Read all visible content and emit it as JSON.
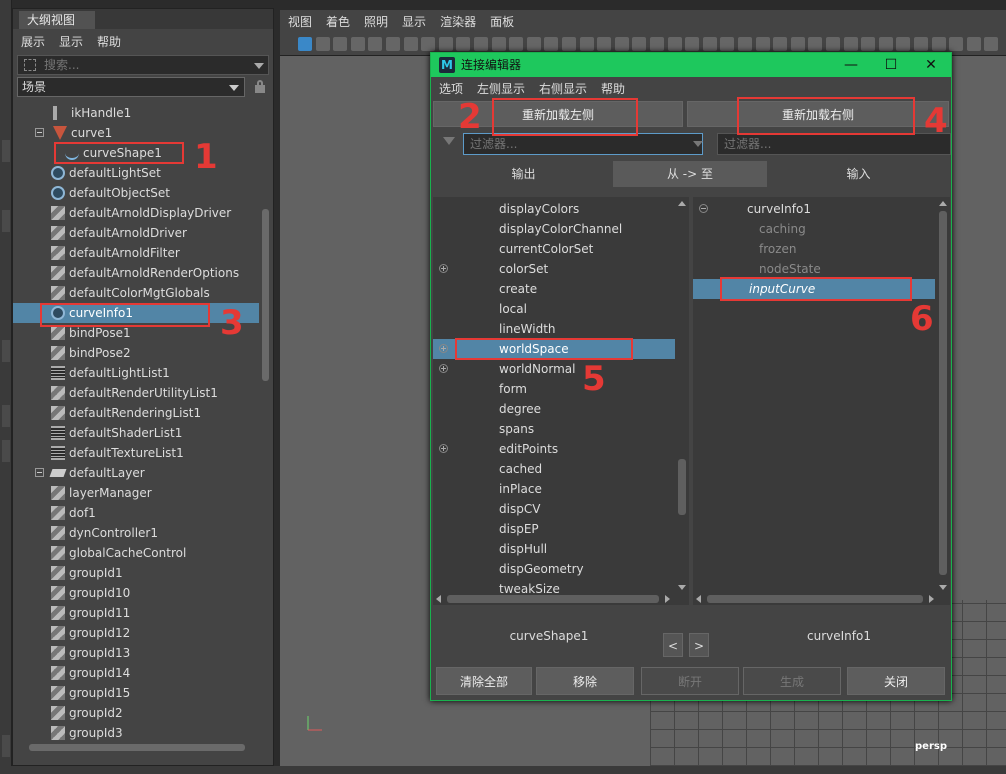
{
  "outliner": {
    "tab": "大纲视图",
    "menu": [
      "展示",
      "显示",
      "帮助"
    ],
    "search_placeholder": "搜索...",
    "scene": "场景",
    "items": [
      {
        "label": "ikHandle1",
        "icon": "ik-handle-icon"
      },
      {
        "label": "curve1",
        "icon": "transform-icon"
      },
      {
        "label": "curveShape1",
        "icon": "curve-icon"
      },
      {
        "label": "defaultLightSet",
        "icon": "set-icon"
      },
      {
        "label": "defaultObjectSet",
        "icon": "set-icon"
      },
      {
        "label": "defaultArnoldDisplayDriver",
        "icon": "node-icon"
      },
      {
        "label": "defaultArnoldDriver",
        "icon": "node-icon"
      },
      {
        "label": "defaultArnoldFilter",
        "icon": "node-icon"
      },
      {
        "label": "defaultArnoldRenderOptions",
        "icon": "node-icon"
      },
      {
        "label": "defaultColorMgtGlobals",
        "icon": "node-icon"
      },
      {
        "label": "curveInfo1",
        "icon": "info-icon"
      },
      {
        "label": "bindPose1",
        "icon": "node-icon"
      },
      {
        "label": "bindPose2",
        "icon": "node-icon"
      },
      {
        "label": "defaultLightList1",
        "icon": "list-icon"
      },
      {
        "label": "defaultRenderUtilityList1",
        "icon": "node-icon"
      },
      {
        "label": "defaultRenderingList1",
        "icon": "node-icon"
      },
      {
        "label": "defaultShaderList1",
        "icon": "list-icon"
      },
      {
        "label": "defaultTextureList1",
        "icon": "list-icon"
      },
      {
        "label": "defaultLayer",
        "icon": "layer-icon"
      },
      {
        "label": "layerManager",
        "icon": "node-icon"
      },
      {
        "label": "dof1",
        "icon": "node-icon"
      },
      {
        "label": "dynController1",
        "icon": "node-icon"
      },
      {
        "label": "globalCacheControl",
        "icon": "node-icon"
      },
      {
        "label": "groupId1",
        "icon": "node-icon"
      },
      {
        "label": "groupId10",
        "icon": "node-icon"
      },
      {
        "label": "groupId11",
        "icon": "node-icon"
      },
      {
        "label": "groupId12",
        "icon": "node-icon"
      },
      {
        "label": "groupId13",
        "icon": "node-icon"
      },
      {
        "label": "groupId14",
        "icon": "node-icon"
      },
      {
        "label": "groupId15",
        "icon": "node-icon"
      },
      {
        "label": "groupId2",
        "icon": "node-icon"
      },
      {
        "label": "groupId3",
        "icon": "node-icon"
      }
    ]
  },
  "viewport": {
    "menu": [
      "视图",
      "着色",
      "照明",
      "显示",
      "渲染器",
      "面板"
    ],
    "camera_label": "persp"
  },
  "editor": {
    "title": "连接编辑器",
    "app_icon_letter": "M",
    "min_glyph": "—",
    "max_glyph": "☐",
    "close_glyph": "✕",
    "menu": [
      "选项",
      "左侧显示",
      "右侧显示",
      "帮助"
    ],
    "reload_left": "重新加载左侧",
    "reload_right": "重新加载右侧",
    "filter_placeholder": "过滤器...",
    "out_label": "输出",
    "direction_label": "从 -> 至",
    "in_label": "输入",
    "left_attrs": [
      {
        "label": "displayColors",
        "expand": false
      },
      {
        "label": "displayColorChannel",
        "expand": false
      },
      {
        "label": "currentColorSet",
        "expand": false
      },
      {
        "label": "colorSet",
        "expand": true
      },
      {
        "label": "create",
        "expand": false
      },
      {
        "label": "local",
        "expand": false
      },
      {
        "label": "lineWidth",
        "expand": false
      },
      {
        "label": "worldSpace",
        "expand": true
      },
      {
        "label": "worldNormal",
        "expand": true
      },
      {
        "label": "form",
        "expand": false
      },
      {
        "label": "degree",
        "expand": false
      },
      {
        "label": "spans",
        "expand": false
      },
      {
        "label": "editPoints",
        "expand": true
      },
      {
        "label": "cached",
        "expand": false
      },
      {
        "label": "inPlace",
        "expand": false
      },
      {
        "label": "dispCV",
        "expand": false
      },
      {
        "label": "dispEP",
        "expand": false
      },
      {
        "label": "dispHull",
        "expand": false
      },
      {
        "label": "dispGeometry",
        "expand": false
      },
      {
        "label": "tweakSize",
        "expand": false
      }
    ],
    "right_attrs": [
      {
        "label": "curveInfo1",
        "style": "parent"
      },
      {
        "label": "caching",
        "style": "dim"
      },
      {
        "label": "frozen",
        "style": "dim"
      },
      {
        "label": "nodeState",
        "style": "dim"
      },
      {
        "label": "inputCurve",
        "style": "italic"
      }
    ],
    "left_node": "curveShape1",
    "right_node": "curveInfo1",
    "nav_prev": "<",
    "nav_next": ">",
    "buttons": {
      "clear_all": "清除全部",
      "remove": "移除",
      "break": "断开",
      "make": "生成",
      "close": "关闭"
    }
  },
  "annotations": [
    "1",
    "2",
    "3",
    "4",
    "5",
    "6"
  ]
}
